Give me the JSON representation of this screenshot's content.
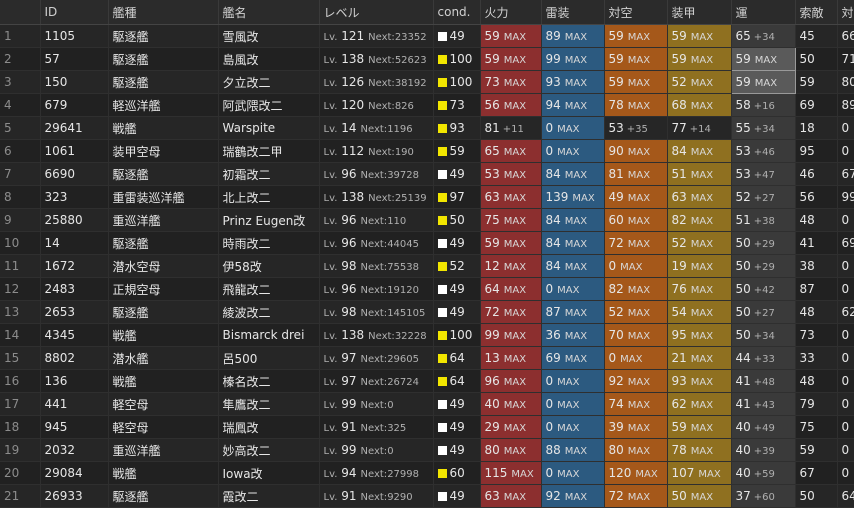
{
  "headers": [
    "",
    "ID",
    "艦種",
    "艦名",
    "レベル",
    "cond.",
    "火力",
    "雷装",
    "対空",
    "装甲",
    "運",
    "索敵",
    "対潜"
  ],
  "colors": {
    "fire": "#8c2f2f",
    "torpedo": "#2c5a80",
    "antiair": "#a5581a",
    "armor": "#8f7020",
    "luck": "#3a3a3a",
    "cond_white": "#ffffff",
    "cond_yellow": "#f2e600"
  },
  "lv_prefix": "Lv.",
  "next_prefix": "Next:",
  "max_label": "MAX",
  "rows": [
    {
      "no": "1",
      "id": "1105",
      "type": "駆逐艦",
      "name": "雪風改",
      "lv": "121",
      "next": "23352",
      "cond": "49",
      "cond_color": "white",
      "fp": "59",
      "fp_extra": "MAX",
      "tp": "89",
      "tp_extra": "MAX",
      "aa": "59",
      "aa_extra": "MAX",
      "ar": "59",
      "ar_extra": "MAX",
      "lk": "65",
      "lk_extra": "+34",
      "los": "45",
      "asw": "66"
    },
    {
      "no": "2",
      "id": "57",
      "type": "駆逐艦",
      "name": "島風改",
      "lv": "138",
      "next": "52623",
      "cond": "100",
      "cond_color": "yellow",
      "fp": "59",
      "fp_extra": "MAX",
      "tp": "99",
      "tp_extra": "MAX",
      "aa": "59",
      "aa_extra": "MAX",
      "ar": "59",
      "ar_extra": "MAX",
      "lk": "59",
      "lk_extra": "MAX",
      "lk_sel": true,
      "los": "50",
      "asw": "71"
    },
    {
      "no": "3",
      "id": "150",
      "type": "駆逐艦",
      "name": "夕立改二",
      "lv": "126",
      "next": "38192",
      "cond": "100",
      "cond_color": "yellow",
      "fp": "73",
      "fp_extra": "MAX",
      "tp": "93",
      "tp_extra": "MAX",
      "aa": "59",
      "aa_extra": "MAX",
      "ar": "52",
      "ar_extra": "MAX",
      "lk": "59",
      "lk_extra": "MAX",
      "lk_sel": true,
      "los": "59",
      "asw": "80"
    },
    {
      "no": "4",
      "id": "679",
      "type": "軽巡洋艦",
      "name": "阿武隈改二",
      "lv": "120",
      "next": "826",
      "cond": "73",
      "cond_color": "yellow",
      "fp": "56",
      "fp_extra": "MAX",
      "tp": "94",
      "tp_extra": "MAX",
      "aa": "78",
      "aa_extra": "MAX",
      "ar": "68",
      "ar_extra": "MAX",
      "lk": "58",
      "lk_extra": "+16",
      "los": "69",
      "asw": "89"
    },
    {
      "no": "5",
      "id": "29641",
      "type": "戦艦",
      "name": "Warspite",
      "lv": "14",
      "next": "1196",
      "cond": "93",
      "cond_color": "yellow",
      "fp": "81",
      "fp_extra": "+11",
      "tp": "0",
      "tp_extra": "MAX",
      "aa": "53",
      "aa_extra": "+35",
      "ar": "77",
      "ar_extra": "+14",
      "lk": "55",
      "lk_extra": "+34",
      "los": "18",
      "asw": "0",
      "plain_row": true
    },
    {
      "no": "6",
      "id": "1061",
      "type": "装甲空母",
      "name": "瑞鶴改二甲",
      "lv": "112",
      "next": "190",
      "cond": "59",
      "cond_color": "yellow",
      "fp": "65",
      "fp_extra": "MAX",
      "tp": "0",
      "tp_extra": "MAX",
      "aa": "90",
      "aa_extra": "MAX",
      "ar": "84",
      "ar_extra": "MAX",
      "lk": "53",
      "lk_extra": "+46",
      "los": "95",
      "asw": "0"
    },
    {
      "no": "7",
      "id": "6690",
      "type": "駆逐艦",
      "name": "初霜改二",
      "lv": "96",
      "next": "39728",
      "cond": "49",
      "cond_color": "white",
      "fp": "53",
      "fp_extra": "MAX",
      "tp": "84",
      "tp_extra": "MAX",
      "aa": "81",
      "aa_extra": "MAX",
      "ar": "51",
      "ar_extra": "MAX",
      "lk": "53",
      "lk_extra": "+47",
      "los": "46",
      "asw": "67"
    },
    {
      "no": "8",
      "id": "323",
      "type": "重雷装巡洋艦",
      "name": "北上改二",
      "lv": "138",
      "next": "25139",
      "cond": "97",
      "cond_color": "yellow",
      "fp": "63",
      "fp_extra": "MAX",
      "tp": "139",
      "tp_extra": "MAX",
      "aa": "49",
      "aa_extra": "MAX",
      "ar": "63",
      "ar_extra": "MAX",
      "lk": "52",
      "lk_extra": "+27",
      "los": "56",
      "asw": "99"
    },
    {
      "no": "9",
      "id": "25880",
      "type": "重巡洋艦",
      "name": "Prinz Eugen改",
      "lv": "96",
      "next": "110",
      "cond": "50",
      "cond_color": "yellow",
      "fp": "75",
      "fp_extra": "MAX",
      "tp": "84",
      "tp_extra": "MAX",
      "aa": "60",
      "aa_extra": "MAX",
      "ar": "82",
      "ar_extra": "MAX",
      "lk": "51",
      "lk_extra": "+38",
      "los": "48",
      "asw": "0"
    },
    {
      "no": "10",
      "id": "14",
      "type": "駆逐艦",
      "name": "時雨改二",
      "lv": "96",
      "next": "44045",
      "cond": "49",
      "cond_color": "white",
      "fp": "59",
      "fp_extra": "MAX",
      "tp": "84",
      "tp_extra": "MAX",
      "aa": "72",
      "aa_extra": "MAX",
      "ar": "52",
      "ar_extra": "MAX",
      "lk": "50",
      "lk_extra": "+29",
      "los": "41",
      "asw": "69"
    },
    {
      "no": "11",
      "id": "1672",
      "type": "潜水空母",
      "name": "伊58改",
      "lv": "98",
      "next": "75538",
      "cond": "52",
      "cond_color": "yellow",
      "fp": "12",
      "fp_extra": "MAX",
      "tp": "84",
      "tp_extra": "MAX",
      "aa": "0",
      "aa_extra": "MAX",
      "ar": "19",
      "ar_extra": "MAX",
      "lk": "50",
      "lk_extra": "+29",
      "los": "38",
      "asw": "0"
    },
    {
      "no": "12",
      "id": "2483",
      "type": "正規空母",
      "name": "飛龍改二",
      "lv": "96",
      "next": "19120",
      "cond": "49",
      "cond_color": "white",
      "fp": "64",
      "fp_extra": "MAX",
      "tp": "0",
      "tp_extra": "MAX",
      "aa": "82",
      "aa_extra": "MAX",
      "ar": "76",
      "ar_extra": "MAX",
      "lk": "50",
      "lk_extra": "+42",
      "los": "87",
      "asw": "0"
    },
    {
      "no": "13",
      "id": "2653",
      "type": "駆逐艦",
      "name": "綾波改二",
      "lv": "98",
      "next": "145105",
      "cond": "49",
      "cond_color": "white",
      "fp": "72",
      "fp_extra": "MAX",
      "tp": "87",
      "tp_extra": "MAX",
      "aa": "52",
      "aa_extra": "MAX",
      "ar": "54",
      "ar_extra": "MAX",
      "lk": "50",
      "lk_extra": "+27",
      "los": "48",
      "asw": "62"
    },
    {
      "no": "14",
      "id": "4345",
      "type": "戦艦",
      "name": "Bismarck drei",
      "lv": "138",
      "next": "32228",
      "cond": "100",
      "cond_color": "yellow",
      "fp": "99",
      "fp_extra": "MAX",
      "tp": "36",
      "tp_extra": "MAX",
      "aa": "70",
      "aa_extra": "MAX",
      "ar": "95",
      "ar_extra": "MAX",
      "lk": "50",
      "lk_extra": "+34",
      "los": "73",
      "asw": "0"
    },
    {
      "no": "15",
      "id": "8802",
      "type": "潜水艦",
      "name": "呂500",
      "lv": "97",
      "next": "29605",
      "cond": "64",
      "cond_color": "yellow",
      "fp": "13",
      "fp_extra": "MAX",
      "tp": "69",
      "tp_extra": "MAX",
      "aa": "0",
      "aa_extra": "MAX",
      "ar": "21",
      "ar_extra": "MAX",
      "lk": "44",
      "lk_extra": "+33",
      "los": "33",
      "asw": "0"
    },
    {
      "no": "16",
      "id": "136",
      "type": "戦艦",
      "name": "榛名改二",
      "lv": "97",
      "next": "26724",
      "cond": "64",
      "cond_color": "yellow",
      "fp": "96",
      "fp_extra": "MAX",
      "tp": "0",
      "tp_extra": "MAX",
      "aa": "92",
      "aa_extra": "MAX",
      "ar": "93",
      "ar_extra": "MAX",
      "lk": "41",
      "lk_extra": "+48",
      "los": "48",
      "asw": "0"
    },
    {
      "no": "17",
      "id": "441",
      "type": "軽空母",
      "name": "隼鷹改二",
      "lv": "99",
      "next": "0",
      "cond": "49",
      "cond_color": "white",
      "fp": "40",
      "fp_extra": "MAX",
      "tp": "0",
      "tp_extra": "MAX",
      "aa": "74",
      "aa_extra": "MAX",
      "ar": "62",
      "ar_extra": "MAX",
      "lk": "41",
      "lk_extra": "+43",
      "los": "79",
      "asw": "0"
    },
    {
      "no": "18",
      "id": "945",
      "type": "軽空母",
      "name": "瑞鳳改",
      "lv": "91",
      "next": "325",
      "cond": "49",
      "cond_color": "white",
      "fp": "29",
      "fp_extra": "MAX",
      "tp": "0",
      "tp_extra": "MAX",
      "aa": "39",
      "aa_extra": "MAX",
      "ar": "59",
      "ar_extra": "MAX",
      "lk": "40",
      "lk_extra": "+49",
      "los": "75",
      "asw": "0"
    },
    {
      "no": "19",
      "id": "2032",
      "type": "重巡洋艦",
      "name": "妙高改二",
      "lv": "99",
      "next": "0",
      "cond": "49",
      "cond_color": "white",
      "fp": "80",
      "fp_extra": "MAX",
      "tp": "88",
      "tp_extra": "MAX",
      "aa": "80",
      "aa_extra": "MAX",
      "ar": "78",
      "ar_extra": "MAX",
      "lk": "40",
      "lk_extra": "+39",
      "los": "59",
      "asw": "0"
    },
    {
      "no": "20",
      "id": "29084",
      "type": "戦艦",
      "name": "Iowa改",
      "lv": "94",
      "next": "27998",
      "cond": "60",
      "cond_color": "yellow",
      "fp": "115",
      "fp_extra": "MAX",
      "tp": "0",
      "tp_extra": "MAX",
      "aa": "120",
      "aa_extra": "MAX",
      "ar": "107",
      "ar_extra": "MAX",
      "lk": "40",
      "lk_extra": "+59",
      "los": "67",
      "asw": "0"
    },
    {
      "no": "21",
      "id": "26933",
      "type": "駆逐艦",
      "name": "霞改二",
      "lv": "91",
      "next": "9290",
      "cond": "49",
      "cond_color": "white",
      "fp": "63",
      "fp_extra": "MAX",
      "tp": "92",
      "tp_extra": "MAX",
      "aa": "72",
      "aa_extra": "MAX",
      "ar": "50",
      "ar_extra": "MAX",
      "lk": "37",
      "lk_extra": "+60",
      "los": "50",
      "asw": "64"
    }
  ]
}
